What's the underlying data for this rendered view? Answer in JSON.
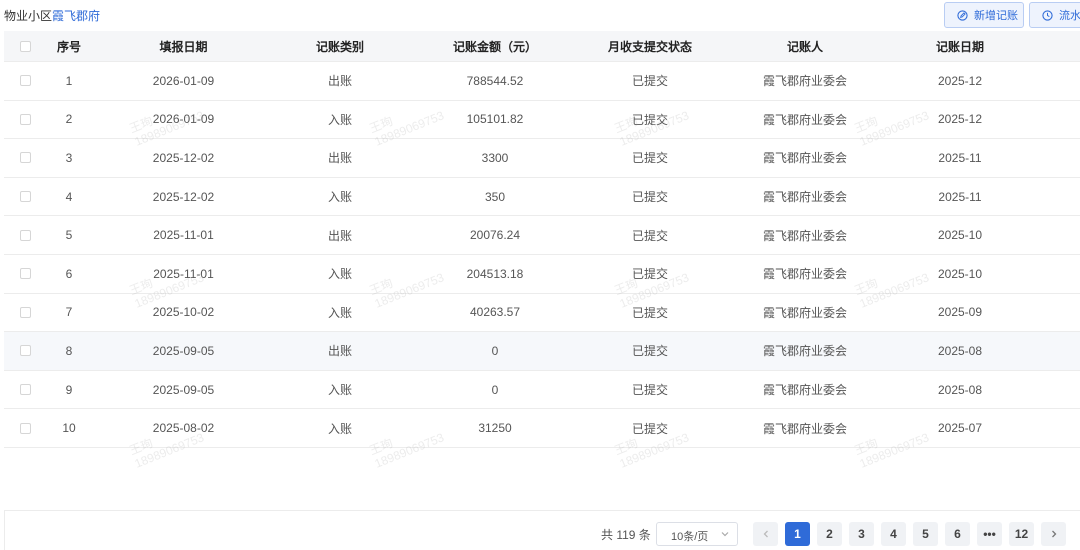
{
  "breadcrumb": {
    "prefix": "物业小区",
    "community": "霞飞郡府"
  },
  "toolbar": {
    "add_label": "新增记账",
    "flow_label": "流水"
  },
  "table": {
    "headers": [
      "序号",
      "填报日期",
      "记账类别",
      "记账金额（元）",
      "月收支提交状态",
      "记账人",
      "记账日期"
    ],
    "rows": [
      {
        "idx": "1",
        "fill_date": "2026-01-09",
        "type": "出账",
        "amount": "788544.52",
        "status": "已提交",
        "user": "霞飞郡府业委会",
        "date": "2025-12"
      },
      {
        "idx": "2",
        "fill_date": "2026-01-09",
        "type": "入账",
        "amount": "105101.82",
        "status": "已提交",
        "user": "霞飞郡府业委会",
        "date": "2025-12"
      },
      {
        "idx": "3",
        "fill_date": "2025-12-02",
        "type": "出账",
        "amount": "3300",
        "status": "已提交",
        "user": "霞飞郡府业委会",
        "date": "2025-11"
      },
      {
        "idx": "4",
        "fill_date": "2025-12-02",
        "type": "入账",
        "amount": "350",
        "status": "已提交",
        "user": "霞飞郡府业委会",
        "date": "2025-11"
      },
      {
        "idx": "5",
        "fill_date": "2025-11-01",
        "type": "出账",
        "amount": "20076.24",
        "status": "已提交",
        "user": "霞飞郡府业委会",
        "date": "2025-10"
      },
      {
        "idx": "6",
        "fill_date": "2025-11-01",
        "type": "入账",
        "amount": "204513.18",
        "status": "已提交",
        "user": "霞飞郡府业委会",
        "date": "2025-10"
      },
      {
        "idx": "7",
        "fill_date": "2025-10-02",
        "type": "入账",
        "amount": "40263.57",
        "status": "已提交",
        "user": "霞飞郡府业委会",
        "date": "2025-09"
      },
      {
        "idx": "8",
        "fill_date": "2025-09-05",
        "type": "出账",
        "amount": "0",
        "status": "已提交",
        "user": "霞飞郡府业委会",
        "date": "2025-08"
      },
      {
        "idx": "9",
        "fill_date": "2025-09-05",
        "type": "入账",
        "amount": "0",
        "status": "已提交",
        "user": "霞飞郡府业委会",
        "date": "2025-08"
      },
      {
        "idx": "10",
        "fill_date": "2025-08-02",
        "type": "入账",
        "amount": "31250",
        "status": "已提交",
        "user": "霞飞郡府业委会",
        "date": "2025-07"
      }
    ]
  },
  "pagination": {
    "total": "共 119 条",
    "page_size": "10条/页",
    "pages": [
      "1",
      "2",
      "3",
      "4",
      "5",
      "6",
      "•••",
      "12"
    ],
    "current": "1"
  },
  "watermark": {
    "name": "王珣",
    "phone": "18989069753"
  },
  "colors": {
    "accent": "#2f6bd8",
    "header_bg": "#f5f6f8",
    "highlight_row": "#f6f8fb"
  }
}
